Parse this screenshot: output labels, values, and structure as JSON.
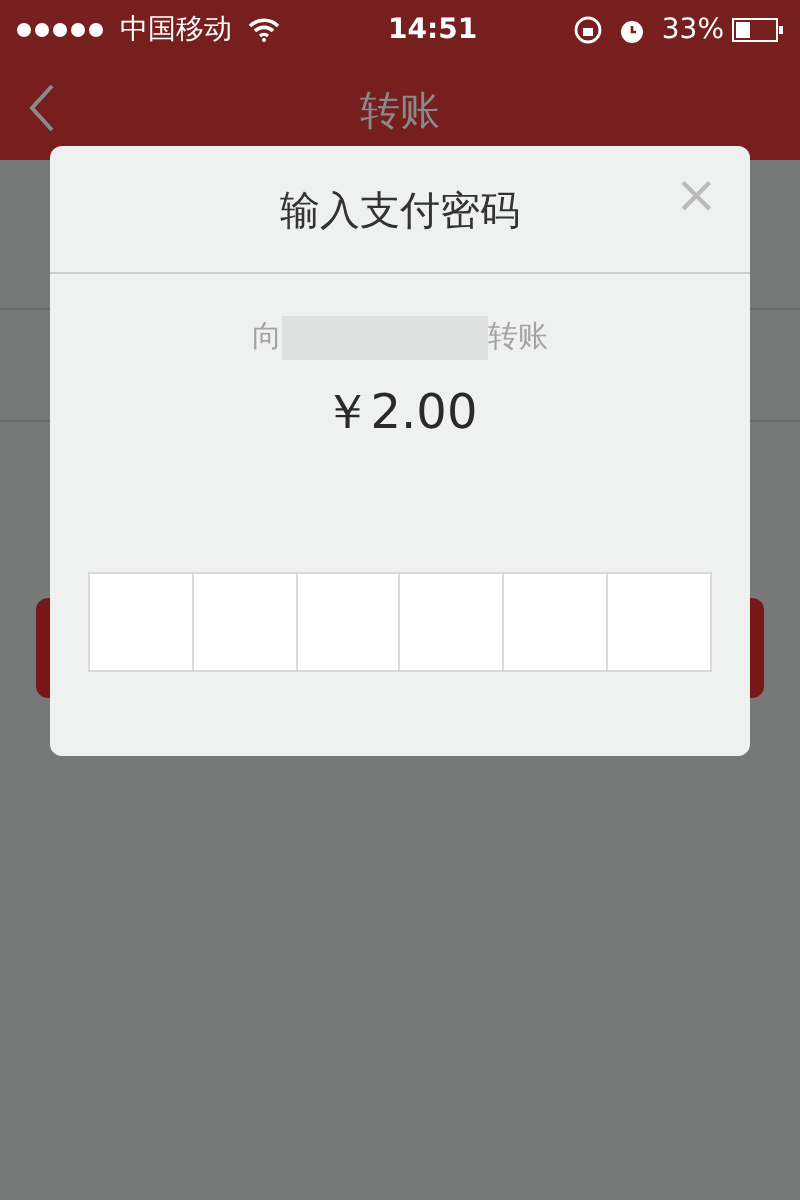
{
  "status_bar": {
    "carrier": "中国移动",
    "time": "14:51",
    "battery": "33%"
  },
  "nav": {
    "title": "转账"
  },
  "dialog": {
    "title": "输入支付密码",
    "close": "×",
    "recipient_prefix": "向",
    "recipient_suffix": "转账",
    "amount": "￥2.00",
    "pin_cells": [
      {
        "filled": false
      },
      {
        "filled": false
      },
      {
        "filled": false
      },
      {
        "filled": false
      },
      {
        "filled": false
      },
      {
        "filled": false
      }
    ]
  }
}
